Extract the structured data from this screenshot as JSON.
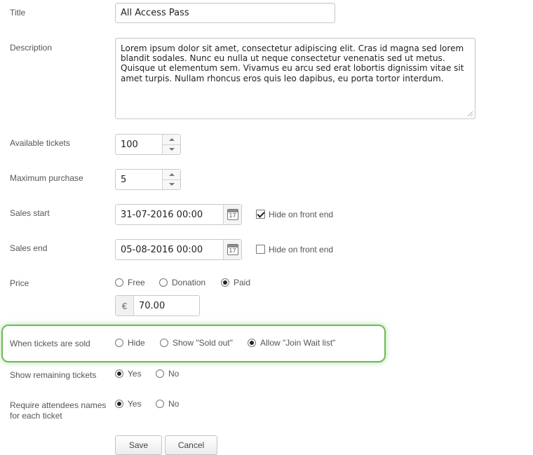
{
  "form": {
    "title": {
      "label": "Title",
      "value": "All Access Pass"
    },
    "description": {
      "label": "Description",
      "value": "Lorem ipsum dolor sit amet, consectetur adipiscing elit. Cras id magna sed lorem blandit sodales. Nunc eu nulla ut neque consectetur venenatis sed ut metus. Quisque ut elementum sem. Vivamus eu arcu sed erat lobortis dignissim vitae sit amet turpis. Nullam rhoncus eros quis leo dapibus, eu porta tortor interdum."
    },
    "available_tickets": {
      "label": "Available tickets",
      "value": "100"
    },
    "maximum_purchase": {
      "label": "Maximum purchase",
      "value": "5"
    },
    "sales_start": {
      "label": "Sales start",
      "value": "31-07-2016 00:00",
      "hide_label": "Hide on front end",
      "hide_checked": true
    },
    "sales_end": {
      "label": "Sales end",
      "value": "05-08-2016 00:00",
      "hide_label": "Hide on front end",
      "hide_checked": false
    },
    "price": {
      "label": "Price",
      "options": [
        "Free",
        "Donation",
        "Paid"
      ],
      "selected": "Paid",
      "currency_symbol": "€",
      "amount": "70.00"
    },
    "when_sold": {
      "label": "When tickets are sold",
      "options": [
        "Hide",
        "Show \"Sold out\"",
        "Allow \"Join Wait list\""
      ],
      "selected": "Allow \"Join Wait list\""
    },
    "show_remaining": {
      "label": "Show remaining tickets",
      "options": [
        "Yes",
        "No"
      ],
      "selected": "Yes"
    },
    "require_names": {
      "label_line1": "Require attendees names",
      "label_line2": "for each ticket",
      "options": [
        "Yes",
        "No"
      ],
      "selected": "Yes"
    }
  },
  "buttons": {
    "save": "Save",
    "cancel": "Cancel"
  },
  "colors": {
    "highlight_border": "#6dbb55"
  }
}
